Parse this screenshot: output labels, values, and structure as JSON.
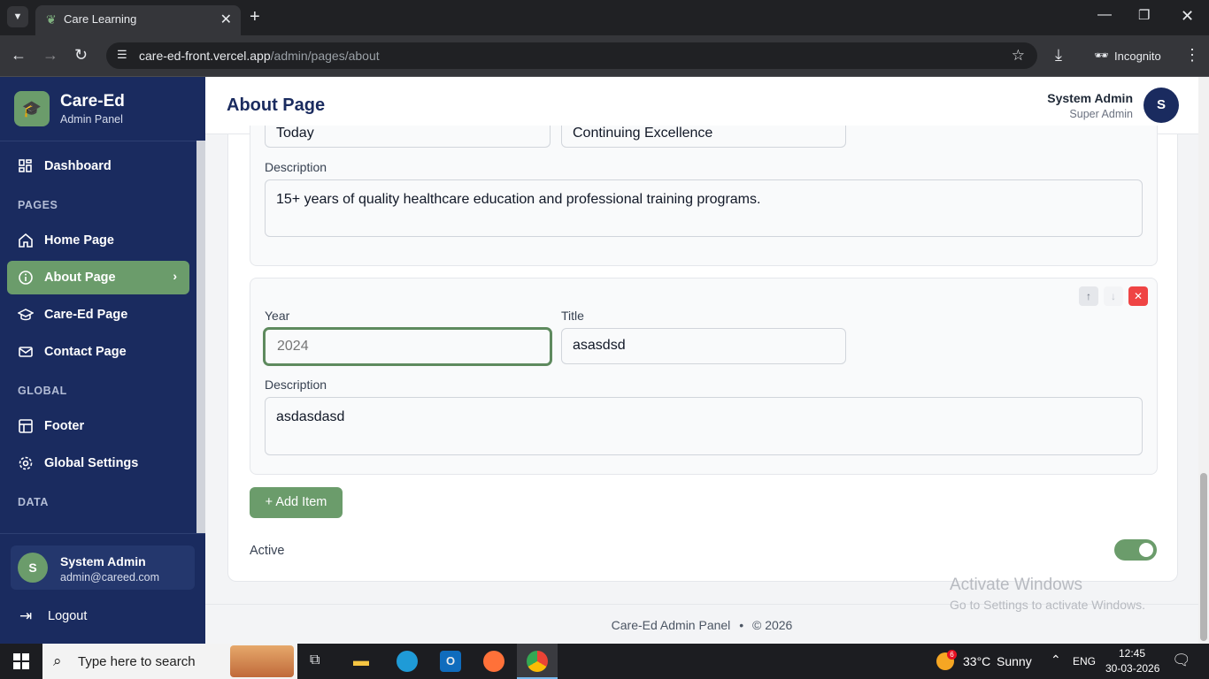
{
  "browser": {
    "tab_title": "Care Learning",
    "url_host": "care-ed-front.vercel.app",
    "url_path": "/admin/pages/about",
    "incognito_label": "Incognito"
  },
  "sidebar": {
    "brand_title": "Care-Ed",
    "brand_subtitle": "Admin Panel",
    "dashboard": "Dashboard",
    "section_pages": "PAGES",
    "home": "Home Page",
    "about": "About Page",
    "careed": "Care-Ed Page",
    "contact": "Contact Page",
    "section_global": "GLOBAL",
    "footer": "Footer",
    "global_settings": "Global Settings",
    "section_data": "DATA",
    "user_initial": "S",
    "user_name": "System Admin",
    "user_email": "admin@careed.com",
    "logout": "Logout"
  },
  "header": {
    "title": "About Page",
    "user_name": "System Admin",
    "user_role": "Super Admin",
    "avatar_initial": "S"
  },
  "timeline_prev": {
    "year_value": "Today",
    "title_value": "Continuing Excellence",
    "description_label": "Description",
    "description_value": "15+ years of quality healthcare education and professional training programs."
  },
  "timeline_item": {
    "year_label": "Year",
    "year_placeholder": "2024",
    "title_label": "Title",
    "title_value": "asasdsd",
    "description_label": "Description",
    "description_value": "asdasdasd"
  },
  "add_item_label": "+ Add Item",
  "active_label": "Active",
  "active_state": true,
  "footer_text": "Care-Ed Admin Panel",
  "footer_bullet": "•",
  "footer_copy": "© 2026",
  "watermark": {
    "line1": "Activate Windows",
    "line2": "Go to Settings to activate Windows."
  },
  "taskbar": {
    "search_placeholder": "Type here to search",
    "weather_temp": "33°C",
    "weather_desc": "Sunny",
    "weather_badge": "6",
    "lang": "ENG",
    "time": "12:45",
    "date": "30-03-2026"
  },
  "colors": {
    "sidebar_bg": "#1a2b5f",
    "accent_green": "#6b9c6b",
    "danger": "#ef4444"
  }
}
